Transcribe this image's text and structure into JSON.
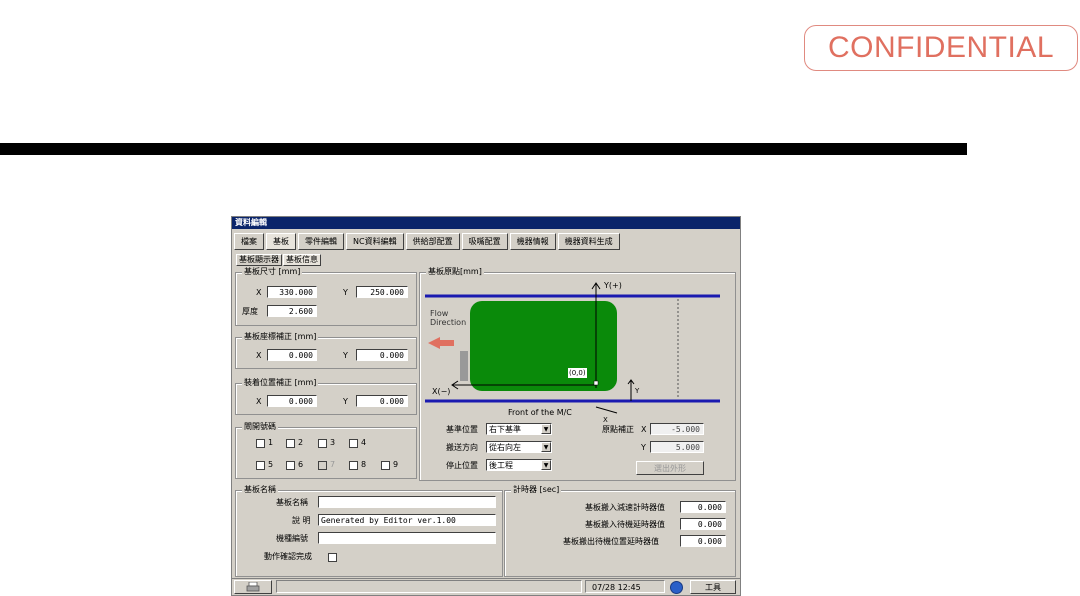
{
  "confidential_label": "CONFIDENTIAL",
  "window": {
    "title": "資料編輯",
    "tabs": [
      "檔案",
      "基板",
      "零件編輯",
      "NC資料編輯",
      "供給部配置",
      "吸嘴配置",
      "機器情報",
      "機器資料生成"
    ],
    "active_tab": "基板",
    "subtabs": [
      "基板顯示器",
      "基板信息"
    ],
    "active_subtab": "基板信息"
  },
  "board_size": {
    "title": "基板尺寸 [mm]",
    "x_label": "X",
    "x": "330.000",
    "y_label": "Y",
    "y": "250.000",
    "thickness_label": "厚度",
    "thickness": "2.600"
  },
  "board_offset": {
    "title": "基板座標補正 [mm]",
    "x_label": "X",
    "x": "0.000",
    "y_label": "Y",
    "y": "0.000"
  },
  "mount_offset": {
    "title": "裝着位置補正 [mm]",
    "x_label": "X",
    "x": "0.000",
    "y_label": "Y",
    "y": "0.000"
  },
  "gates": {
    "title": "閘開號碼",
    "items": [
      "1",
      "2",
      "3",
      "4",
      "5",
      "6",
      "7",
      "8",
      "9"
    ],
    "checked": [],
    "disabled": [
      "7"
    ]
  },
  "origin": {
    "title": "基板原點[mm]",
    "y_axis_label": "Y(+)",
    "x_axis_label": "X(−)",
    "flow_label_1": "Flow",
    "flow_label_2": "Direction",
    "origin_label": "(0,0)",
    "front_label": "Front of the M/C",
    "x_small": "X",
    "y_small": "Y",
    "ref_pos_label": "基準位置",
    "ref_pos_value": "右下基準",
    "conv_dir_label": "搬送方向",
    "conv_dir_value": "從右向左",
    "stop_pos_label": "停止位置",
    "stop_pos_value": "後工程",
    "origin_corr_label": "原點補正",
    "corr_x_label": "X",
    "corr_x": "-5.000",
    "corr_y_label": "Y",
    "corr_y": "5.000",
    "calc_button": "選出外形"
  },
  "board_name": {
    "title": "基板名稱",
    "name_label": "基板名稱",
    "name_value": "",
    "desc_label": "說 明",
    "desc_value": "Generated by Editor ver.1.00",
    "model_label": "機種編號",
    "model_value": "",
    "confirm_label": "動作確認完成"
  },
  "timer": {
    "title": "計時器 [sec]",
    "rows": [
      {
        "label": "基板搬入減速計時器值",
        "value": "0.000"
      },
      {
        "label": "基板搬入待機延時器值",
        "value": "0.000"
      },
      {
        "label": "基板搬出待機位置延時器值",
        "value": "0.000"
      }
    ]
  },
  "status": {
    "datetime": "07/28 12:45",
    "tools_label": "工具"
  },
  "colors": {
    "board_green": "#0a8a0a",
    "rail_blue": "#1a1ab0",
    "arrow_red": "#e07060"
  }
}
